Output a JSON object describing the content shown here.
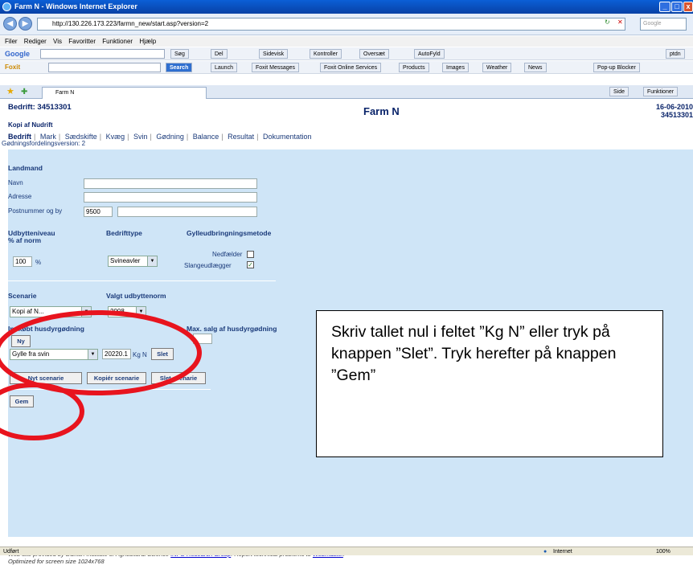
{
  "window": {
    "title": "Farm N - Windows Internet Explorer"
  },
  "address": {
    "url": "http://130.226.173.223/farmn_new/start.asp?version=2",
    "search_placeholder": "Google"
  },
  "menu": [
    "Filer",
    "Rediger",
    "Vis",
    "Favoritter",
    "Funktioner",
    "Hjælp"
  ],
  "toolbar_google": {
    "label": "Google",
    "items": [
      "Søg",
      "Del",
      "Sidevisk",
      "Kontroller",
      "Oversæt",
      "AutoFyld",
      "ptdn"
    ]
  },
  "toolbar_foxit": {
    "label": "Foxit",
    "search": "Search",
    "items": [
      "Launch",
      "Foxit Messages",
      "Foxit Online Services",
      "Products",
      "Images",
      "Weather",
      "News",
      "Pop-up Blocker"
    ]
  },
  "tabbar": {
    "tab_label": "Farm N",
    "items": [
      "Side",
      "Funktioner"
    ]
  },
  "page": {
    "bedrift": "Bedrift: 34513301",
    "app_title": "Farm N",
    "date": "16-06-2010",
    "date_id": "34513301",
    "scenario_name": "Kopi af Nudrift",
    "tabs": [
      "Bedrift",
      "Mark",
      "Sædskifte",
      "Kvæg",
      "Svin",
      "Gødning",
      "Balance",
      "Resultat",
      "Dokumentation"
    ],
    "version_text": "Gødningsfordelingsversion: 2",
    "landmand_header": "Landmand",
    "navn_label": "Navn",
    "adresse_label": "Adresse",
    "postnr_label": "Postnummer og by",
    "postnr_value": "9500",
    "udbytte_header": "Udbytteniveau",
    "udbytte_sub": "% af norm",
    "udbytte_value": "100",
    "udbytte_unit": "%",
    "bedriftstype_header": "Bedrifttype",
    "bedriftstype_value": "Svineavler",
    "gylle_header": "Gylleudbringningsmetode",
    "nedfaelder_label": "Nedfælder",
    "slange_label": "Slangeudlægger",
    "scenarie_header": "Scenarie",
    "scenarie_value": "Kopi af N...",
    "valgt_header": "Valgt udbyttenorm",
    "valgt_value": "2008",
    "indkobt_header": "Indkøbt husdyrgødning",
    "ny_button": "Ny",
    "maxsalg_header": "Max. salg af husdyrgødning",
    "gylle_select": "Gylle fra svin",
    "kg_value": "20220.1",
    "kg_unit": "Kg N",
    "slet_button": "Slet",
    "nyt_scenarie": "Nyt scenarie",
    "kopier_scenarie": "Kopiér scenarie",
    "slet_scenarie": "Slet scenarie",
    "gem_button": "Gem",
    "footer_line1_a": "Web site provided by Danish Institute of Agricultural Science ",
    "footer_link1": "INFO Research Group",
    "footer_line1_b": ". Report technical problems to ",
    "footer_link2": "Webmaster",
    "footer_line2": "Optimized for screen size 1024x768"
  },
  "callout": {
    "text": "Skriv tallet nul i feltet ”Kg N” eller tryk på knappen ”Slet”. Tryk herefter på knappen ”Gem”"
  },
  "status": {
    "left": "Udført",
    "zone": "Internet",
    "zoom": "100%"
  },
  "colors": {
    "form_bg": "#cfe5f7",
    "annotation": "#e8141e",
    "header_blue": "#0a246a"
  }
}
